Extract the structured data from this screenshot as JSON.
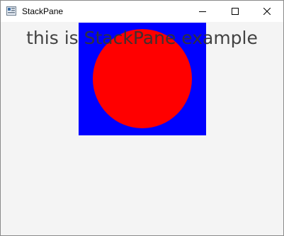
{
  "window": {
    "title": "StackPane",
    "icon": "java-app-icon",
    "controls": {
      "minimize_icon": "minimize-icon",
      "maximize_icon": "maximize-icon",
      "close_icon": "close-icon"
    }
  },
  "content": {
    "background_color": "#f4f4f4",
    "rectangle_color": "#0000ff",
    "circle_color": "#ff0000",
    "label": "this is StackPane example",
    "label_color": "#333333"
  }
}
